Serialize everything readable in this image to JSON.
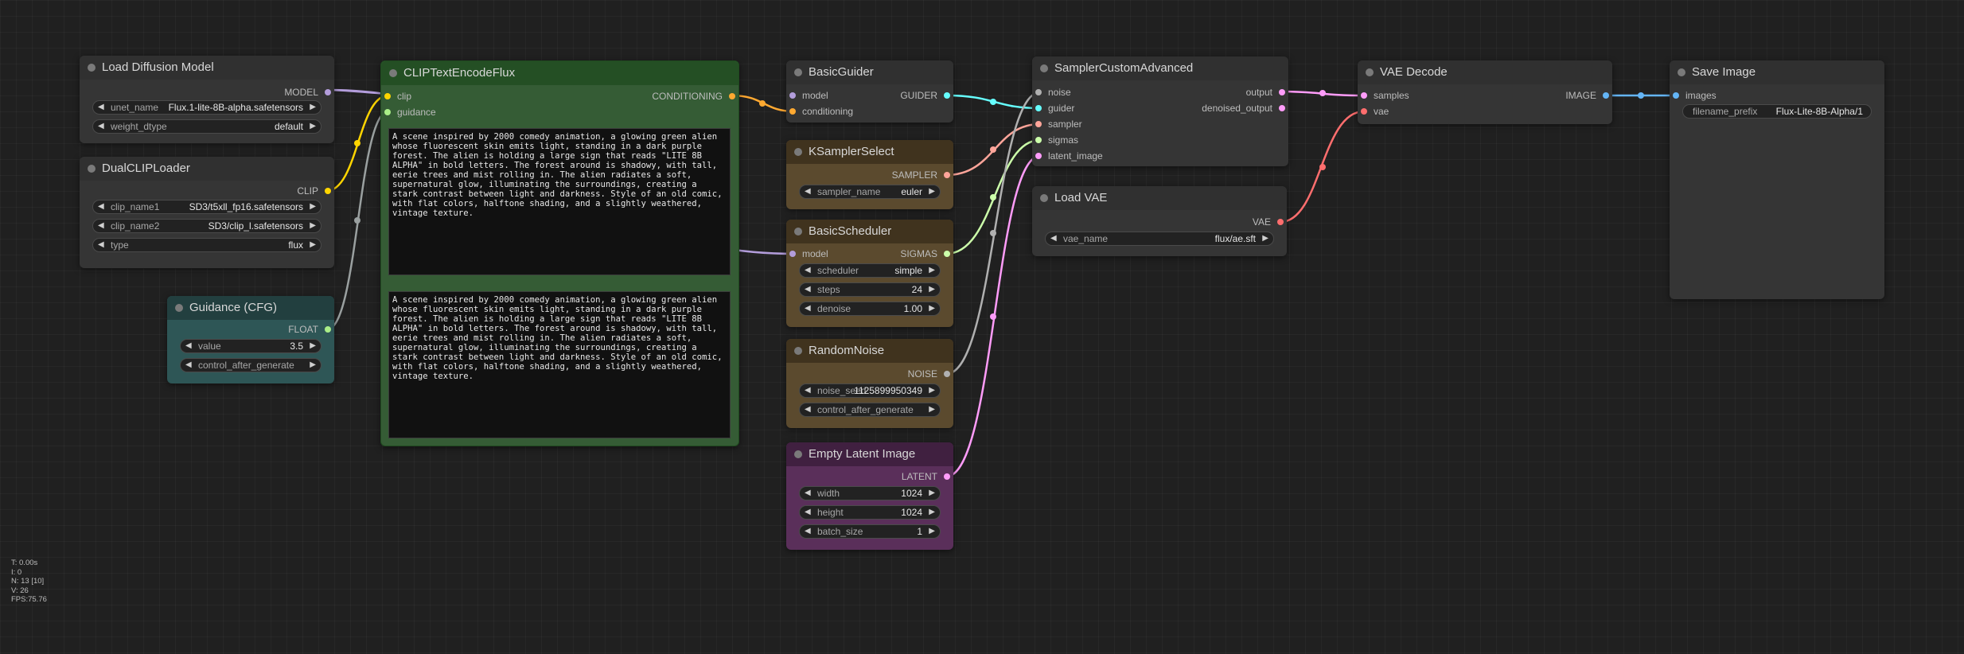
{
  "nodes": {
    "load_diffusion_model": {
      "title": "Load Diffusion Model",
      "output": "MODEL",
      "unet_name": {
        "label": "unet_name",
        "value": "Flux.1-lite-8B-alpha.safetensors"
      },
      "weight_dtype": {
        "label": "weight_dtype",
        "value": "default"
      }
    },
    "dual_clip_loader": {
      "title": "DualCLIPLoader",
      "output": "CLIP",
      "clip_name1": {
        "label": "clip_name1",
        "value": "SD3/t5xll_fp16.safetensors"
      },
      "clip_name2": {
        "label": "clip_name2",
        "value": "SD3/clip_l.safetensors"
      },
      "type": {
        "label": "type",
        "value": "flux"
      }
    },
    "guidance_cfg": {
      "title": "Guidance (CFG)",
      "output": "FLOAT",
      "value": {
        "label": "value",
        "value": "3.5"
      },
      "control": {
        "label": "control_after_generate",
        "value": ""
      }
    },
    "clip_text_encode_flux": {
      "title": "CLIPTextEncodeFlux",
      "input_clip": "clip",
      "input_guidance": "guidance",
      "output": "CONDITIONING",
      "text_clip_l": "A scene inspired by 2000 comedy animation, a glowing green alien whose fluorescent skin emits light, standing in a dark purple forest. The alien is holding a large sign that reads \"LITE 8B ALPHA\" in bold letters. The forest around is shadowy, with tall, eerie trees and mist rolling in. The alien radiates a soft, supernatural glow, illuminating the surroundings, creating a stark contrast between light and darkness. Style of an old comic, with flat colors, halftone shading, and a slightly weathered, vintage texture.",
      "text_t5xxl": "A scene inspired by 2000 comedy animation, a glowing green alien whose fluorescent skin emits light, standing in a dark purple forest. The alien is holding a large sign that reads \"LITE 8B ALPHA\" in bold letters. The forest around is shadowy, with tall, eerie trees and mist rolling in. The alien radiates a soft, supernatural glow, illuminating the surroundings, creating a stark contrast between light and darkness. Style of an old comic, with flat colors, halftone shading, and a slightly weathered, vintage texture."
    },
    "basic_guider": {
      "title": "BasicGuider",
      "input_model": "model",
      "input_conditioning": "conditioning",
      "output": "GUIDER"
    },
    "ksampler_select": {
      "title": "KSamplerSelect",
      "output": "SAMPLER",
      "sampler_name": {
        "label": "sampler_name",
        "value": "euler"
      }
    },
    "basic_scheduler": {
      "title": "BasicScheduler",
      "input_model": "model",
      "output": "SIGMAS",
      "scheduler": {
        "label": "scheduler",
        "value": "simple"
      },
      "steps": {
        "label": "steps",
        "value": "24"
      },
      "denoise": {
        "label": "denoise",
        "value": "1.00"
      }
    },
    "random_noise": {
      "title": "RandomNoise",
      "output": "NOISE",
      "noise_seed": {
        "label": "noise_seed",
        "value": "1125899950349"
      },
      "control": {
        "label": "control_after_generate",
        "value": ""
      }
    },
    "empty_latent_image": {
      "title": "Empty Latent Image",
      "output": "LATENT",
      "width": {
        "label": "width",
        "value": "1024"
      },
      "height": {
        "label": "height",
        "value": "1024"
      },
      "batch_size": {
        "label": "batch_size",
        "value": "1"
      }
    },
    "sampler_custom_advanced": {
      "title": "SamplerCustomAdvanced",
      "inputs": [
        "noise",
        "guider",
        "sampler",
        "sigmas",
        "latent_image"
      ],
      "output": "output",
      "output2": "denoised_output"
    },
    "load_vae": {
      "title": "Load VAE",
      "output": "VAE",
      "vae_name": {
        "label": "vae_name",
        "value": "flux/ae.sft"
      }
    },
    "vae_decode": {
      "title": "VAE Decode",
      "input_samples": "samples",
      "input_vae": "vae",
      "output": "IMAGE"
    },
    "save_image": {
      "title": "Save Image",
      "input_images": "images",
      "filename_prefix": {
        "label": "filename_prefix",
        "value": "Flux-Lite-8B-Alpha/1"
      }
    }
  },
  "stats": [
    "T: 0.00s",
    "I: 0",
    "N: 13 [10]",
    "V: 26",
    "FPS:75.76"
  ],
  "colors": {
    "model": "#b39ddb",
    "clip": "#ffd500",
    "conditioning": "#ffa931",
    "float": "#aaee88",
    "guider": "#66ffff",
    "sampler": "#ffa59a",
    "sigmas": "#ccffaa",
    "noise": "#b0b0b0",
    "latent": "#ff9cf9",
    "vae": "#ff6e6e",
    "image": "#64b5f6"
  }
}
